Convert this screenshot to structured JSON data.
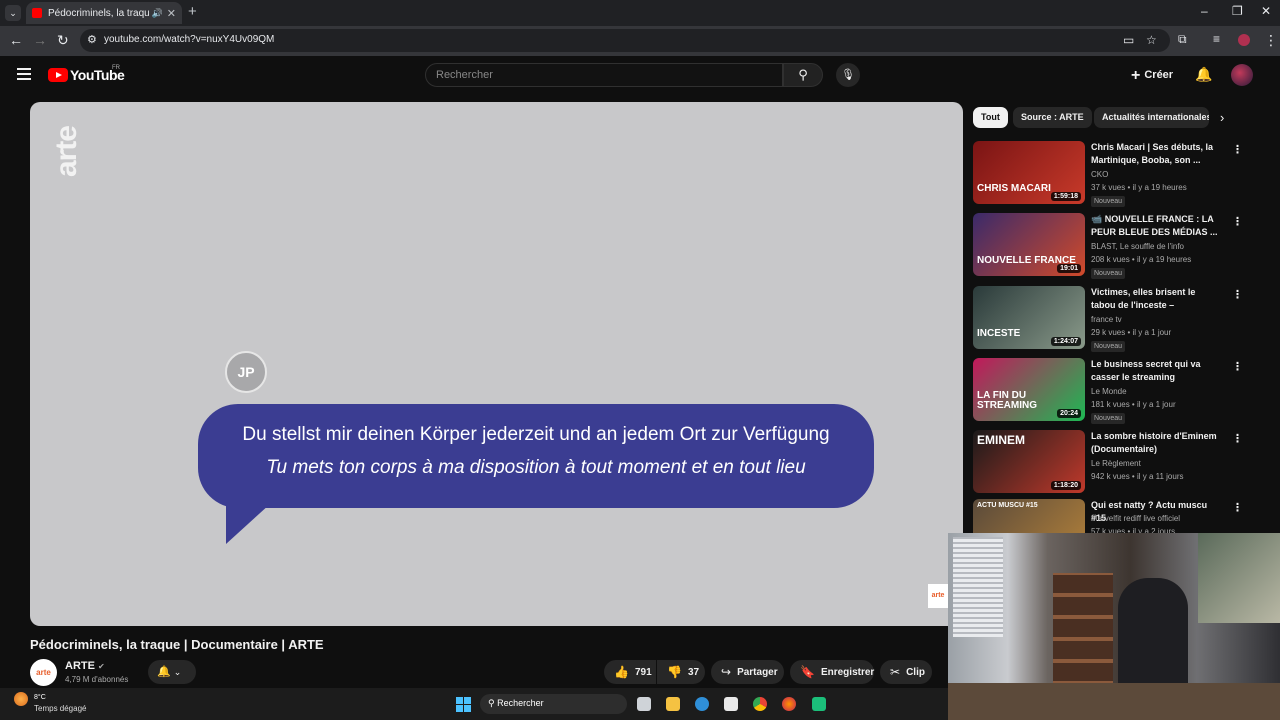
{
  "browser": {
    "tab_title": "Pédocriminels, la traque | D",
    "new_tab": "+",
    "url": "youtube.com/watch?v=nuxY4Uv09QM"
  },
  "header": {
    "logo_text": "YouTube",
    "country": "FR",
    "search_placeholder": "Rechercher",
    "create_label": "Créer"
  },
  "video": {
    "watermark": "arte",
    "speaker_initials": "JP",
    "subtitle_de": "Du stellst mir deinen Körper jederzeit und an jedem Ort zur Verfügung",
    "subtitle_fr": "Tu mets ton corps à ma disposition à tout moment et en tout lieu",
    "corner_logo": "arte"
  },
  "meta": {
    "title": "Pédocriminels, la traque | Documentaire | ARTE",
    "channel": "ARTE",
    "channel_avatar": "arte",
    "subscribers": "4,79 M d'abonnés",
    "likes": "791",
    "dislikes": "37",
    "share_label": "Partager",
    "save_label": "Enregistrer",
    "clip_label": "Clip"
  },
  "chips": [
    "Tout",
    "Source : ARTE",
    "Actualités internationales"
  ],
  "recommendations": [
    {
      "title": "Chris Macari | Ses débuts, la Martinique, Booba, son ...",
      "channel": "CKO",
      "meta": "37 k vues • il y a 19 heures",
      "badge": "Nouveau",
      "duration": "1:59:18",
      "thumb_text": "CHRIS MACARI",
      "colors": [
        "#7a1414",
        "#c83a2a"
      ]
    },
    {
      "title": "📹 NOUVELLE FRANCE : LA PEUR BLEUE DES MÉDIAS ...",
      "channel": "BLAST, Le souffle de l'info",
      "meta": "208 k vues • il y a 19 heures",
      "badge": "Nouveau",
      "duration": "19:01",
      "thumb_text": "NOUVELLE FRANCE",
      "colors": [
        "#3a2a6a",
        "#d14a2a"
      ]
    },
    {
      "title": "Victimes, elles brisent le tabou de l'inceste – Documentaire ...",
      "channel": "france tv",
      "meta": "29 k vues • il y a 1 jour",
      "badge": "Nouveau",
      "duration": "1:24:07",
      "thumb_text": "INCESTE",
      "colors": [
        "#2a3a3a",
        "#8a9a8a"
      ]
    },
    {
      "title": "Le business secret qui va casser le streaming",
      "channel": "Le Monde",
      "meta": "181 k vues • il y a 1 jour",
      "badge": "Nouveau",
      "duration": "20:24",
      "thumb_text": "LA FIN DU STREAMING",
      "colors": [
        "#c2185b",
        "#1db954"
      ]
    },
    {
      "title": "La sombre histoire d'Eminem (Documentaire)",
      "channel": "Le Règlement",
      "meta": "942 k vues • il y a 11 jours",
      "badge": "",
      "duration": "1:18:20",
      "thumb_text": "EMINEM",
      "colors": [
        "#1a1a1a",
        "#c0392b"
      ]
    },
    {
      "title": "Qui est natty ? Actu muscu #15",
      "channel": "Marvelfit rediff live officiel",
      "meta": "57 k vues • il y a 2 jours",
      "badge": "",
      "duration": "",
      "thumb_text": "ACTU MUSCU #15",
      "colors": [
        "#5a4a3a",
        "#b4823a"
      ]
    }
  ],
  "taskbar": {
    "temperature": "8°C",
    "weather": "Temps dégagé",
    "search": "Rechercher"
  },
  "colors": {
    "bubble": "#3b3d92",
    "youtube_red": "#ff0000"
  }
}
